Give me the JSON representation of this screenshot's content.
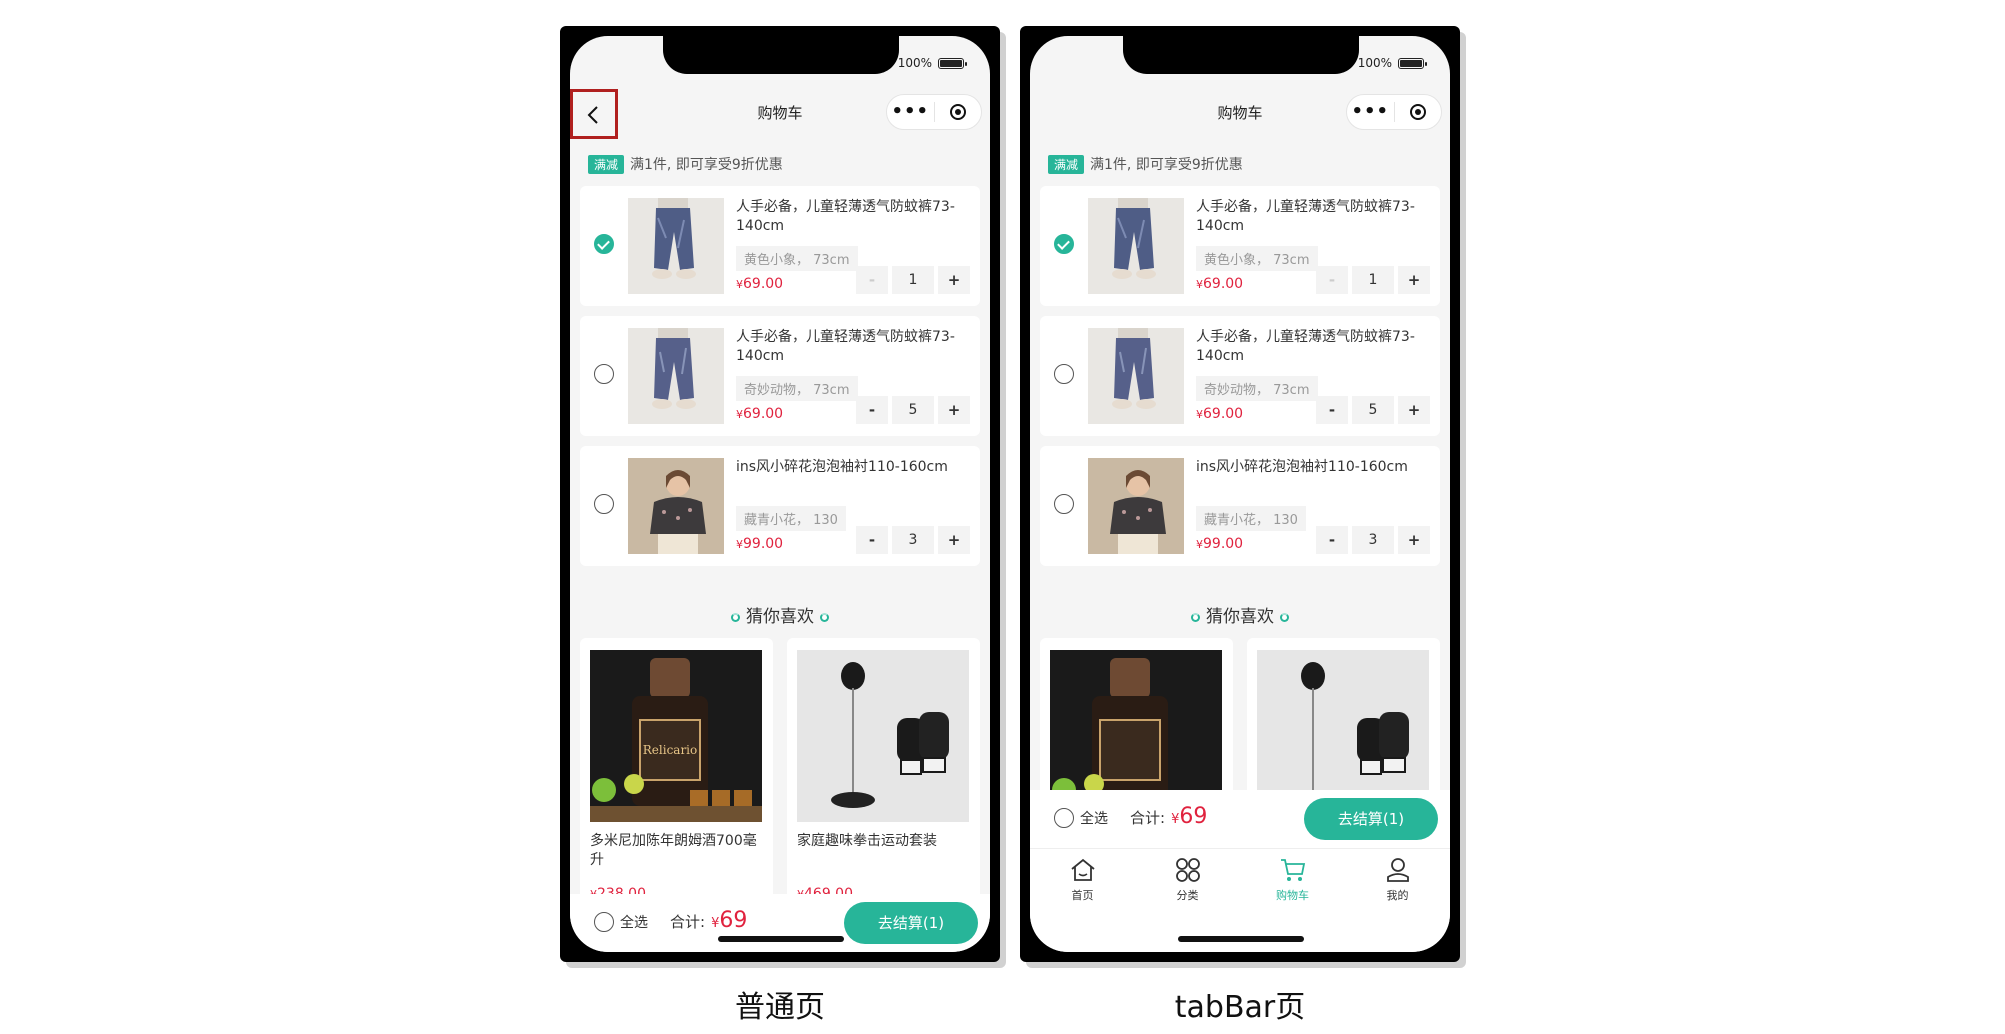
{
  "left_phone": {
    "status": "100%",
    "title": "购物车",
    "caption": "普通页",
    "promo": {
      "tag": "满减",
      "text": "满1件, 即可享受9折优惠"
    },
    "items": [
      {
        "title": "人手必备，儿童轻薄透气防蚊裤73-140cm",
        "spec": "黄色小象， 73cm",
        "price": "69.00",
        "qty": "1",
        "checked": true
      },
      {
        "title": "人手必备，儿童轻薄透气防蚊裤73-140cm",
        "spec": "奇妙动物， 73cm",
        "price": "69.00",
        "qty": "5",
        "checked": false
      },
      {
        "title": "ins风小碎花泡泡袖衬110-160cm",
        "spec": "藏青小花， 130",
        "price": "99.00",
        "qty": "3",
        "checked": false
      }
    ],
    "guess": "猜你喜欢",
    "recs": [
      {
        "name": "多米尼加陈年朗姆酒700毫升",
        "price": "238.00"
      },
      {
        "name": "家庭趣味拳击运动套装",
        "price": "469.00"
      }
    ],
    "bottom": {
      "select_all": "全选",
      "total_label": "合计:",
      "currency": "¥",
      "total": "69",
      "checkout": "去结算(1)"
    }
  },
  "right_phone": {
    "status": "100%",
    "title": "购物车",
    "caption": "tabBar页",
    "promo": {
      "tag": "满减",
      "text": "满1件, 即可享受9折优惠"
    },
    "items": [
      {
        "title": "人手必备，儿童轻薄透气防蚊裤73-140cm",
        "spec": "黄色小象， 73cm",
        "price": "69.00",
        "qty": "1",
        "checked": true
      },
      {
        "title": "人手必备，儿童轻薄透气防蚊裤73-140cm",
        "spec": "奇妙动物， 73cm",
        "price": "69.00",
        "qty": "5",
        "checked": false
      },
      {
        "title": "ins风小碎花泡泡袖衬110-160cm",
        "spec": "藏青小花， 130",
        "price": "99.00",
        "qty": "3",
        "checked": false
      }
    ],
    "guess": "猜你喜欢",
    "bottom": {
      "select_all": "全选",
      "total_label": "合计:",
      "currency": "¥",
      "total": "69",
      "checkout": "去结算(1)"
    },
    "tabs": [
      "首页",
      "分类",
      "购物车",
      "我的"
    ],
    "active_tab": "购物车"
  },
  "price_currency": "¥",
  "accent_color": "#27b599",
  "price_color": "#e0223e",
  "highlight_color": "#b0201f"
}
